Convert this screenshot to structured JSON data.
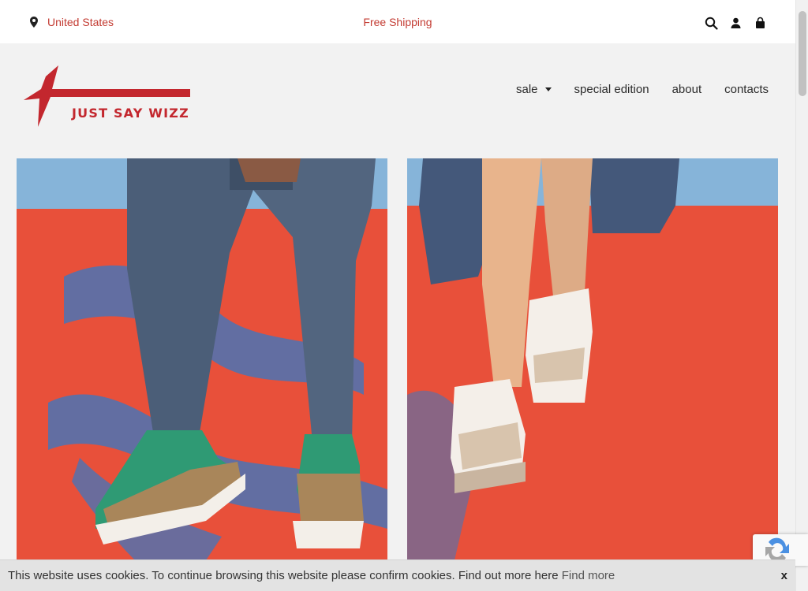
{
  "topbar": {
    "location_label": "United States",
    "shipping_label": "Free Shipping",
    "icons": [
      "search-icon",
      "user-icon",
      "bag-icon"
    ]
  },
  "brand": {
    "name": "JUST SAY WIZZ",
    "color": "#c3272e"
  },
  "nav": {
    "items": [
      {
        "label": "sale",
        "has_dropdown": true
      },
      {
        "label": "special edition",
        "has_dropdown": false
      },
      {
        "label": "about",
        "has_dropdown": false
      },
      {
        "label": "contacts",
        "has_dropdown": false
      }
    ]
  },
  "hero": {
    "photos": [
      {
        "name": "hero-photo-green-sneakers"
      },
      {
        "name": "hero-photo-white-sneakers"
      }
    ]
  },
  "cookie": {
    "message": "This website uses cookies. To continue browsing this website please confirm cookies. Find out more here",
    "more_label": "Find more",
    "close_label": "x"
  },
  "colors": {
    "accent": "#c33b32",
    "wall": "#e8503a",
    "sky": "#7fb0d8",
    "denim": "#4b5e78"
  }
}
